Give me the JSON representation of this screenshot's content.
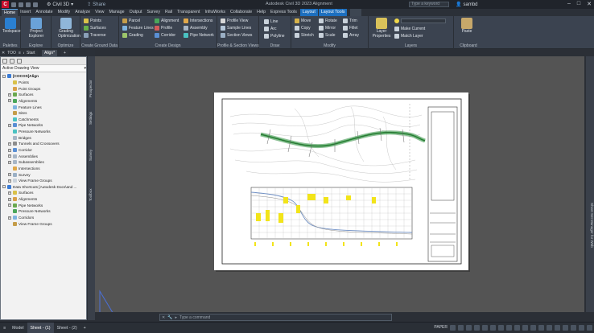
{
  "app": {
    "logo_letter": "C",
    "workspace": "Civil 3D",
    "share_label": "Share",
    "title": "Autodesk Civil 3D 2023  Alignment",
    "search_placeholder": "Type a keyword",
    "user": "sambd",
    "window_buttons": [
      "–",
      "□",
      "✕"
    ]
  },
  "ribbon_tabs": [
    "Home",
    "Insert",
    "Annotate",
    "Modify",
    "Analyze",
    "View",
    "Manage",
    "Output",
    "Survey",
    "Rail",
    "Transparent",
    "InfraWorks",
    "Collaborate",
    "Help",
    "Express Tools"
  ],
  "context_tabs": [
    "Layout",
    "Layout Tools"
  ],
  "ribbon": {
    "palettes": {
      "big_label": "Toolspace",
      "title": "Palettes"
    },
    "explore": {
      "big_label": "Project Explorer",
      "title": "Explore"
    },
    "optimize": {
      "big_label": "Grading Optimization",
      "title": "Optimize"
    },
    "ground": {
      "items": [
        "Points",
        "Surfaces",
        "Traverse"
      ],
      "title": "Create Ground Data"
    },
    "design": {
      "col1": [
        "Parcel",
        "Feature Lines",
        "Grading"
      ],
      "col2": [
        "Alignment",
        "Profile",
        "Corridor"
      ],
      "col3": [
        "Intersections",
        "Assembly",
        "Pipe Network"
      ],
      "title": "Create Design"
    },
    "profile": {
      "items": [
        "Profile View",
        "Sample Lines",
        "Section Views"
      ],
      "title": "Profile & Section Views"
    },
    "draw": {
      "items": [
        "Line",
        "Arc",
        "Polyline"
      ],
      "title": "Draw"
    },
    "modify": {
      "col1": [
        "Move",
        "Copy",
        "Stretch"
      ],
      "col2": [
        "Rotate",
        "Mirror",
        "Scale"
      ],
      "col3": [
        "Trim",
        "Fillet",
        "Array"
      ],
      "title": "Modify"
    },
    "layers": {
      "big_label": "Layer Properties",
      "items": [
        "Make Current",
        "Match Layer"
      ],
      "title": "Layers"
    },
    "clipboard": {
      "big_label": "Paste",
      "title": "Clipboard"
    }
  },
  "doc_tabs": [
    "Start",
    "Align*"
  ],
  "toolspace": {
    "title": "TOOLSPACE",
    "view": "Active Drawing View",
    "vertical_tabs": [
      "Prospector",
      "Settings",
      "Survey",
      "Toolbox"
    ],
    "tree": [
      {
        "label": "[COCOS]Align",
        "level": 0,
        "exp": "-",
        "sel": true
      },
      {
        "label": "Points",
        "level": 1,
        "exp": ""
      },
      {
        "label": "Point Groups",
        "level": 1,
        "exp": ""
      },
      {
        "label": "Surfaces",
        "level": 1,
        "exp": "+"
      },
      {
        "label": "Alignments",
        "level": 1,
        "exp": "+"
      },
      {
        "label": "Feature Lines",
        "level": 1,
        "exp": ""
      },
      {
        "label": "Sites",
        "level": 1,
        "exp": ""
      },
      {
        "label": "Catchments",
        "level": 1,
        "exp": ""
      },
      {
        "label": "Pipe Networks",
        "level": 1,
        "exp": "+"
      },
      {
        "label": "Pressure Networks",
        "level": 1,
        "exp": ""
      },
      {
        "label": "Bridges",
        "level": 1,
        "exp": ""
      },
      {
        "label": "Tunnels and Crossovers",
        "level": 1,
        "exp": "+"
      },
      {
        "label": "Corridor",
        "level": 1,
        "exp": "+"
      },
      {
        "label": "Assemblies",
        "level": 1,
        "exp": "+"
      },
      {
        "label": "Subassemblies",
        "level": 1,
        "exp": "+"
      },
      {
        "label": "Intersections",
        "level": 1,
        "exp": ""
      },
      {
        "label": "Survey",
        "level": 1,
        "exp": "+"
      },
      {
        "label": "View Frame Groups",
        "level": 1,
        "exp": "+"
      },
      {
        "label": "Data Shortcuts [Autodesk Docs\\and ...",
        "level": 0,
        "exp": "-"
      },
      {
        "label": "Surfaces",
        "level": 1,
        "exp": "+"
      },
      {
        "label": "Alignments",
        "level": 1,
        "exp": "+"
      },
      {
        "label": "Pipe Networks",
        "level": 1,
        "exp": "+"
      },
      {
        "label": "Pressure Networks",
        "level": 1,
        "exp": ""
      },
      {
        "label": "Corridors",
        "level": 1,
        "exp": "+"
      },
      {
        "label": "View Frame Groups",
        "level": 1,
        "exp": ""
      }
    ]
  },
  "right_palette_label": "Sheet Set Manager for Web",
  "command_placeholder": "Type a command",
  "layout_tabs": [
    "Model",
    "Sheet - (1)",
    "Sheet - (2)"
  ],
  "status_text": [
    "PAPER"
  ],
  "colors": {
    "accent": "#1d6fbf",
    "alignment": "#3aa64a",
    "highlight": "#f2e41a",
    "profile_line": "#6f8fc4"
  }
}
